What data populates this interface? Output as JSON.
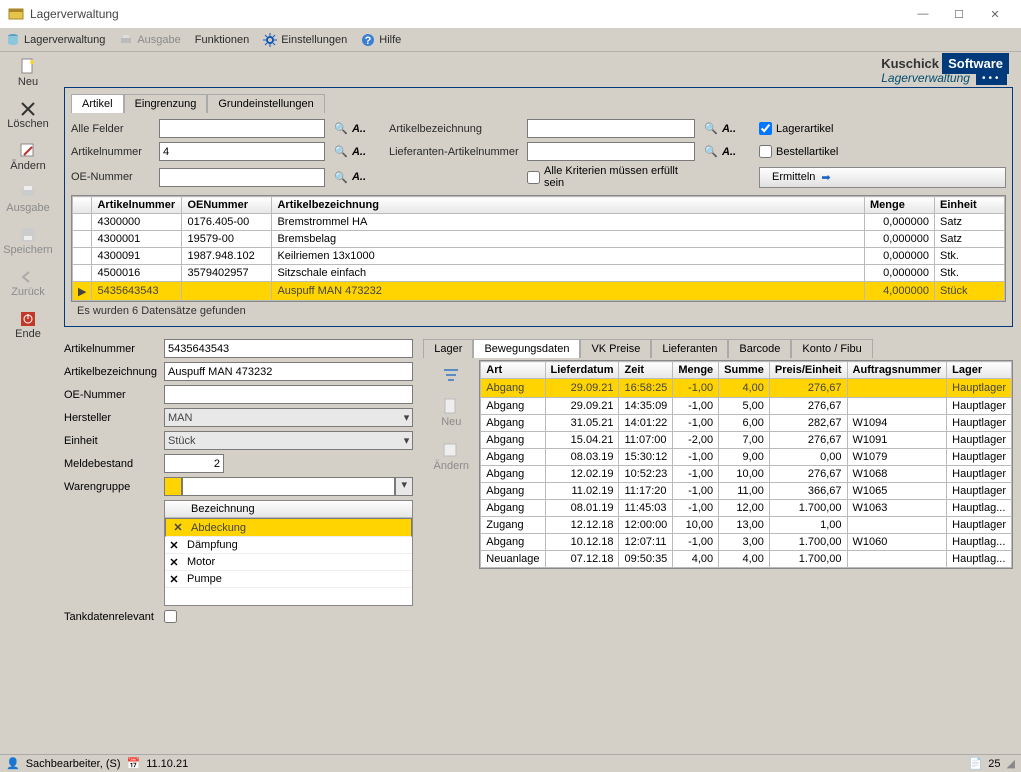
{
  "window": {
    "title": "Lagerverwaltung"
  },
  "menu": {
    "lager": "Lagerverwaltung",
    "ausgabe": "Ausgabe",
    "funktionen": "Funktionen",
    "einstellungen": "Einstellungen",
    "hilfe": "Hilfe"
  },
  "toolbar": {
    "neu": "Neu",
    "loeschen": "Löschen",
    "aendern": "Ändern",
    "ausgabe": "Ausgabe",
    "speichern": "Speichern",
    "zurueck": "Zurück",
    "ende": "Ende"
  },
  "brand": {
    "company": "Kuschick",
    "software": "Software",
    "subtitle": "Lagerverwaltung"
  },
  "tabs": {
    "artikel": "Artikel",
    "eingrenzung": "Eingrenzung",
    "grund": "Grundeinstellungen"
  },
  "search": {
    "alle_felder_label": "Alle Felder",
    "alle_felder_value": "",
    "artikelbezeichnung_label": "Artikelbezeichnung",
    "artikelbezeichnung_value": "",
    "artikelnummer_label": "Artikelnummer",
    "artikelnummer_value": "4",
    "lieferanten_label": "Lieferanten-Artikelnummer",
    "lieferanten_value": "",
    "oe_label": "OE-Nummer",
    "oe_value": "",
    "kriterien_label": "Alle Kriterien müssen erfüllt sein",
    "lagerartikel_label": "Lagerartikel",
    "bestellartikel_label": "Bestellartikel",
    "ermitteln": "Ermitteln"
  },
  "results": {
    "headers": {
      "artnr": "Artikelnummer",
      "oenr": "OENummer",
      "bez": "Artikelbezeichnung",
      "menge": "Menge",
      "einheit": "Einheit"
    },
    "rows": [
      {
        "artnr": "4300000",
        "oenr": "0176.405-00",
        "bez": "Bremstrommel HA",
        "menge": "0,000000",
        "einheit": "Satz",
        "sel": false
      },
      {
        "artnr": "4300001",
        "oenr": "19579-00",
        "bez": "Bremsbelag",
        "menge": "0,000000",
        "einheit": "Satz",
        "sel": false
      },
      {
        "artnr": "4300091",
        "oenr": "1987.948.102",
        "bez": "Keilriemen 13x1000",
        "menge": "0,000000",
        "einheit": "Stk.",
        "sel": false
      },
      {
        "artnr": "4500016",
        "oenr": "3579402957",
        "bez": "Sitzschale einfach",
        "menge": "0,000000",
        "einheit": "Stk.",
        "sel": false
      },
      {
        "artnr": "5435643543",
        "oenr": "",
        "bez": "Auspuff MAN 473232",
        "menge": "4,000000",
        "einheit": "Stück",
        "sel": true
      }
    ],
    "status": "Es wurden 6 Datensätze gefunden"
  },
  "detail": {
    "artikelnummer_label": "Artikelnummer",
    "artikelnummer": "5435643543",
    "bez_label": "Artikelbezeichnung",
    "bez": "Auspuff MAN 473232",
    "oe_label": "OE-Nummer",
    "oe": "",
    "hersteller_label": "Hersteller",
    "hersteller": "MAN",
    "einheit_label": "Einheit",
    "einheit": "Stück",
    "melde_label": "Meldebestand",
    "melde": "2",
    "wgruppe_label": "Warengruppe",
    "wgruppe": "",
    "list_header": "Bezeichnung",
    "list": [
      {
        "name": "Abdeckung",
        "sel": true
      },
      {
        "name": "Dämpfung",
        "sel": false
      },
      {
        "name": "Motor",
        "sel": false
      },
      {
        "name": "Pumpe",
        "sel": false
      }
    ],
    "tank_label": "Tankdatenrelevant"
  },
  "mv_tabs": {
    "lager": "Lager",
    "bewegung": "Bewegungsdaten",
    "vk": "VK Preise",
    "lief": "Lieferanten",
    "barcode": "Barcode",
    "konto": "Konto / Fibu"
  },
  "mv_side": {
    "neu": "Neu",
    "aendern": "Ändern"
  },
  "mv": {
    "headers": {
      "art": "Art",
      "datum": "Lieferdatum",
      "zeit": "Zeit",
      "menge": "Menge",
      "summe": "Summe",
      "preis": "Preis/Einheit",
      "auftrag": "Auftragsnummer",
      "lager": "Lager"
    },
    "rows": [
      {
        "art": "Abgang",
        "datum": "29.09.21",
        "zeit": "16:58:25",
        "menge": "-1,00",
        "summe": "4,00",
        "preis": "276,67",
        "auftrag": "",
        "lager": "Hauptlager",
        "sel": true
      },
      {
        "art": "Abgang",
        "datum": "29.09.21",
        "zeit": "14:35:09",
        "menge": "-1,00",
        "summe": "5,00",
        "preis": "276,67",
        "auftrag": "",
        "lager": "Hauptlager",
        "sel": false
      },
      {
        "art": "Abgang",
        "datum": "31.05.21",
        "zeit": "14:01:22",
        "menge": "-1,00",
        "summe": "6,00",
        "preis": "282,67",
        "auftrag": "W1094",
        "lager": "Hauptlager",
        "sel": false
      },
      {
        "art": "Abgang",
        "datum": "15.04.21",
        "zeit": "11:07:00",
        "menge": "-2,00",
        "summe": "7,00",
        "preis": "276,67",
        "auftrag": "W1091",
        "lager": "Hauptlager",
        "sel": false
      },
      {
        "art": "Abgang",
        "datum": "08.03.19",
        "zeit": "15:30:12",
        "menge": "-1,00",
        "summe": "9,00",
        "preis": "0,00",
        "auftrag": "W1079",
        "lager": "Hauptlager",
        "sel": false
      },
      {
        "art": "Abgang",
        "datum": "12.02.19",
        "zeit": "10:52:23",
        "menge": "-1,00",
        "summe": "10,00",
        "preis": "276,67",
        "auftrag": "W1068",
        "lager": "Hauptlager",
        "sel": false
      },
      {
        "art": "Abgang",
        "datum": "11.02.19",
        "zeit": "11:17:20",
        "menge": "-1,00",
        "summe": "11,00",
        "preis": "366,67",
        "auftrag": "W1065",
        "lager": "Hauptlager",
        "sel": false
      },
      {
        "art": "Abgang",
        "datum": "08.01.19",
        "zeit": "11:45:03",
        "menge": "-1,00",
        "summe": "12,00",
        "preis": "1.700,00",
        "auftrag": "W1063",
        "lager": "Hauptlag...",
        "sel": false
      },
      {
        "art": "Zugang",
        "datum": "12.12.18",
        "zeit": "12:00:00",
        "menge": "10,00",
        "summe": "13,00",
        "preis": "1,00",
        "auftrag": "",
        "lager": "Hauptlager",
        "sel": false
      },
      {
        "art": "Abgang",
        "datum": "10.12.18",
        "zeit": "12:07:11",
        "menge": "-1,00",
        "summe": "3,00",
        "preis": "1.700,00",
        "auftrag": "W1060",
        "lager": "Hauptlag...",
        "sel": false
      },
      {
        "art": "Neuanlage",
        "datum": "07.12.18",
        "zeit": "09:50:35",
        "menge": "4,00",
        "summe": "4,00",
        "preis": "1.700,00",
        "auftrag": "",
        "lager": "Hauptlag...",
        "sel": false
      }
    ]
  },
  "statusbar": {
    "user": "Sachbearbeiter, (S)",
    "date": "11.10.21",
    "count": "25"
  }
}
